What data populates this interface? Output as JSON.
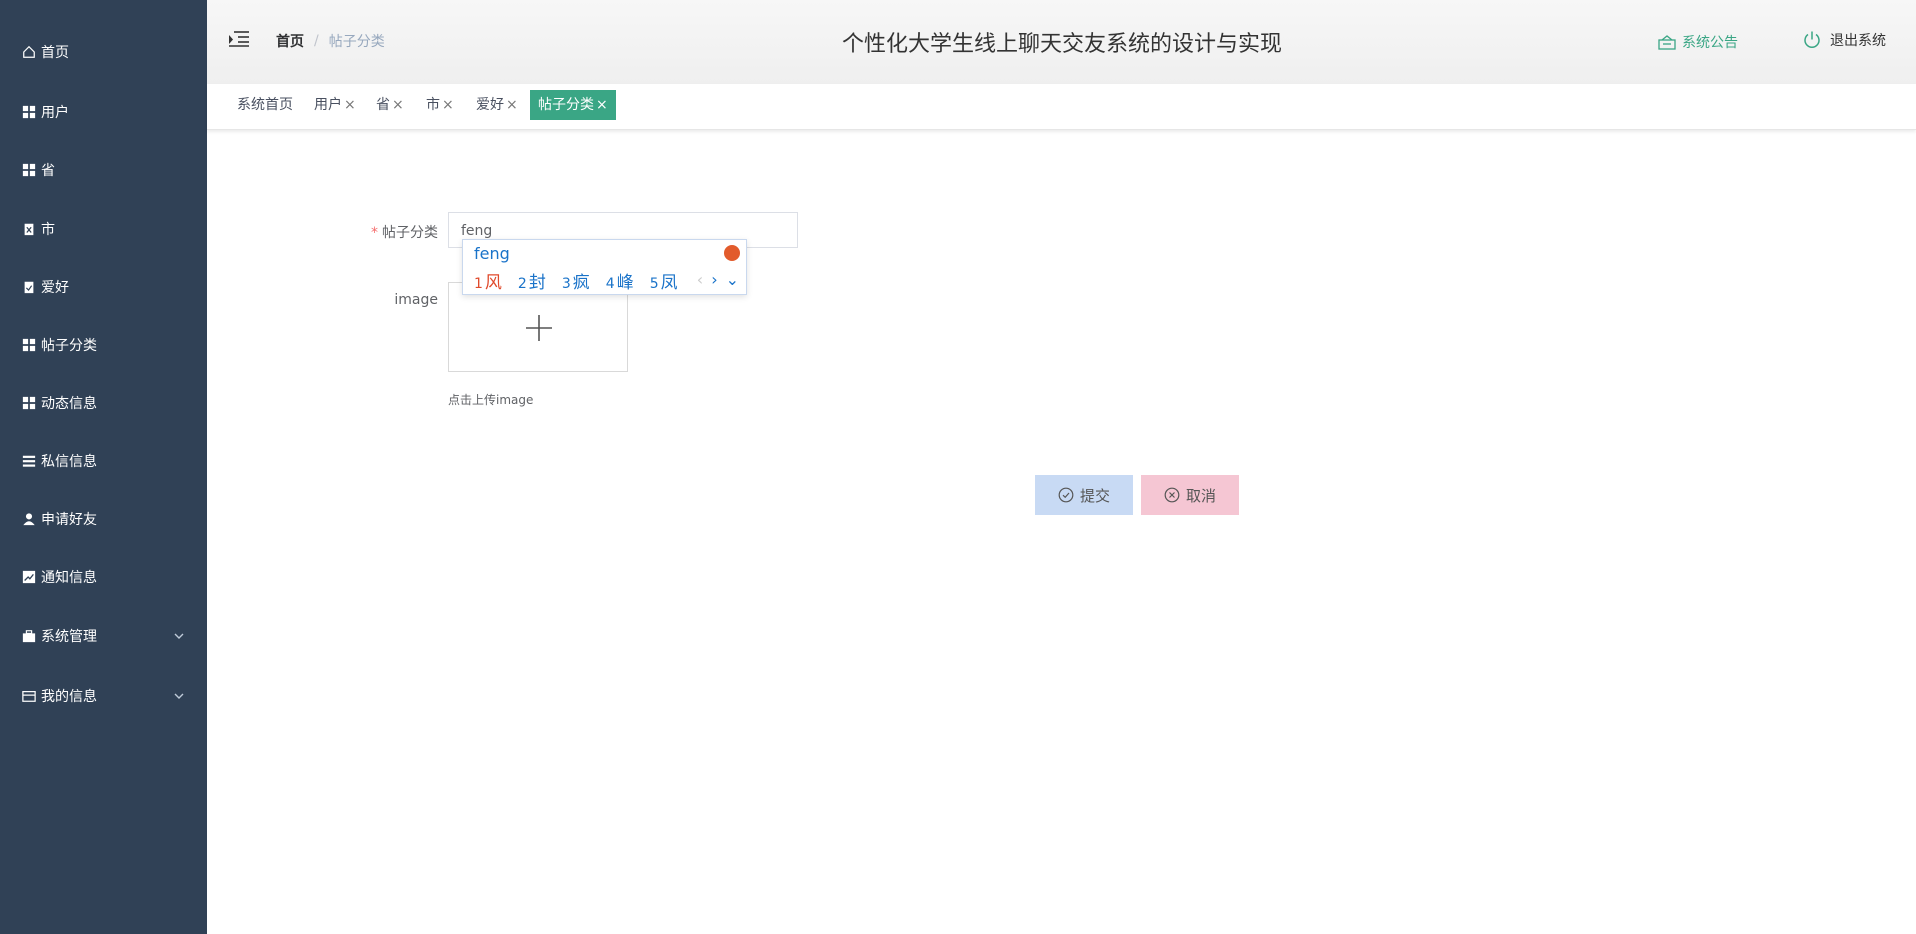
{
  "sidebar": {
    "items": [
      {
        "label": "首页",
        "icon": "home-icon"
      },
      {
        "label": "用户",
        "icon": "grid-icon"
      },
      {
        "label": "省",
        "icon": "grid-icon"
      },
      {
        "label": "市",
        "icon": "clipboard-icon"
      },
      {
        "label": "爱好",
        "icon": "clipboard-check-icon"
      },
      {
        "label": "帖子分类",
        "icon": "grid-icon"
      },
      {
        "label": "动态信息",
        "icon": "grid-icon"
      },
      {
        "label": "私信信息",
        "icon": "list-icon"
      },
      {
        "label": "申请好友",
        "icon": "user-icon"
      },
      {
        "label": "通知信息",
        "icon": "chart-icon"
      },
      {
        "label": "系统管理",
        "icon": "briefcase-icon"
      },
      {
        "label": "我的信息",
        "icon": "wallet-icon"
      }
    ]
  },
  "header": {
    "breadcrumb_home": "首页",
    "breadcrumb_sep": "/",
    "breadcrumb_current": "帖子分类",
    "title": "个性化大学生线上聊天交友系统的设计与实现",
    "notice_label": "系统公告",
    "logout_label": "退出系统"
  },
  "tags": {
    "items": [
      "系统首页",
      "用户",
      "省",
      "市",
      "爱好",
      "帖子分类"
    ],
    "close": "×"
  },
  "form": {
    "category_label": "帖子分类",
    "required_mark": "*",
    "category_value": "feng",
    "image_label": "image",
    "upload_hint": "点击上传image",
    "submit_label": "提交",
    "cancel_label": "取消"
  },
  "ime": {
    "composition": "feng",
    "candidates": [
      {
        "n": "1",
        "text": "风"
      },
      {
        "n": "2",
        "text": "封"
      },
      {
        "n": "3",
        "text": "疯"
      },
      {
        "n": "4",
        "text": "峰"
      },
      {
        "n": "5",
        "text": "凤"
      }
    ],
    "prev": "‹",
    "next": "›",
    "expand": "⌄"
  },
  "colors": {
    "sidebar_bg": "#304156",
    "accent": "#3aa685",
    "submit_bg": "#c8daf4",
    "cancel_bg": "#f5c6d3"
  }
}
